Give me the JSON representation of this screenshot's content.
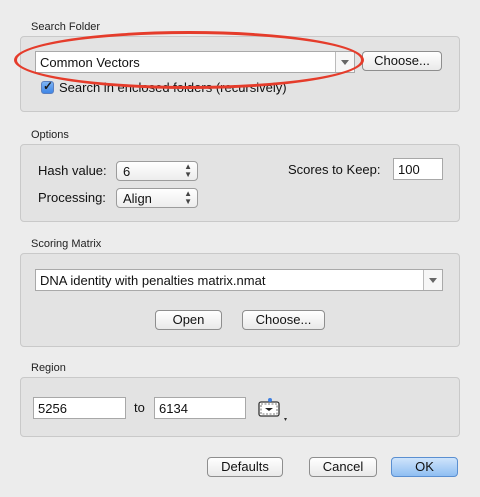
{
  "search_folder": {
    "section_label": "Search Folder",
    "folder_value": "Common Vectors",
    "choose_label": "Choose...",
    "recursive_label": "Search in enclosed folders (recursively)",
    "recursive_checked": true
  },
  "options": {
    "section_label": "Options",
    "hash_label": "Hash value:",
    "hash_value": "6",
    "processing_label": "Processing:",
    "processing_value": "Align",
    "scores_label": "Scores to Keep:",
    "scores_value": "100"
  },
  "scoring_matrix": {
    "section_label": "Scoring Matrix",
    "matrix_value": "DNA identity with penalties matrix.nmat",
    "open_label": "Open",
    "choose_label": "Choose..."
  },
  "region": {
    "section_label": "Region",
    "start_value": "5256",
    "to_label": "to",
    "end_value": "6134",
    "icon": "region-selection-icon"
  },
  "footer": {
    "defaults_label": "Defaults",
    "cancel_label": "Cancel",
    "ok_label": "OK"
  },
  "colors": {
    "annotation_ring": "#e53c2b",
    "default_button": "#8fbef2"
  }
}
